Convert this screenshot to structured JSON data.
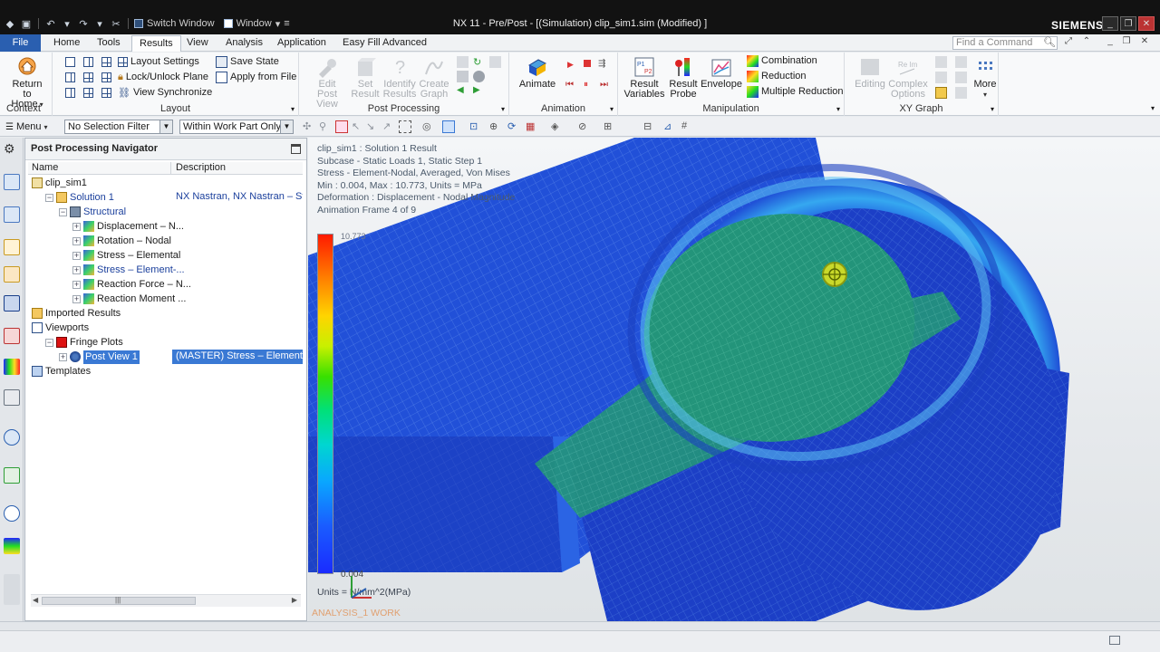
{
  "titlebar": {
    "quick_switch_window": "Switch Window",
    "quick_window": "Window",
    "title": "NX 11 - Pre/Post - [(Simulation) clip_sim1.sim (Modified) ]",
    "brand": "SIEMENS"
  },
  "tabs": [
    "File",
    "Home",
    "Tools",
    "Results",
    "View",
    "Analysis",
    "Application",
    "Easy Fill Advanced"
  ],
  "active_tab": "Results",
  "find_command_placeholder": "Find a Command",
  "ribbon": {
    "context": {
      "return_home": "Return to",
      "return_home2": "Home",
      "label": "Context"
    },
    "layout": {
      "layout_settings": "Layout Settings",
      "lock_unlock_plane": "Lock/Unlock Plane",
      "view_synchronize": "View Synchronize",
      "save_state": "Save State",
      "apply_from_file": "Apply from File",
      "label": "Layout"
    },
    "post_processing": {
      "edit_post_view": [
        "Edit Post",
        "View"
      ],
      "set_result": [
        "Set",
        "Result"
      ],
      "identify_results": [
        "Identify",
        "Results"
      ],
      "create_graph": [
        "Create",
        "Graph"
      ],
      "label": "Post Processing"
    },
    "animation": {
      "animate": "Animate",
      "label": "Animation"
    },
    "manipulation": {
      "result_variables": [
        "Result",
        "Variables"
      ],
      "result_probe": [
        "Result",
        "Probe"
      ],
      "envelope": "Envelope",
      "combination": "Combination",
      "reduction": "Reduction",
      "multiple_reduction": "Multiple Reduction",
      "label": "Manipulation"
    },
    "xy_graph": {
      "editing": "Editing",
      "complex_options": [
        "Complex",
        "Options"
      ],
      "label": "XY Graph"
    },
    "more": "More"
  },
  "command_strip": {
    "menu": "Menu",
    "selection_filter": "No Selection Filter",
    "scope": "Within Work Part Only"
  },
  "navigator": {
    "title": "Post Processing Navigator",
    "columns": {
      "name": "Name",
      "description": "Description"
    },
    "rows": [
      {
        "name": "clip_sim1",
        "desc": "",
        "indent": 0,
        "expander": "",
        "icon": "sim"
      },
      {
        "name": "Solution 1",
        "desc": "NX Nastran, NX Nastran – Str",
        "indent": 1,
        "expander": "−",
        "icon": "folder",
        "blue": true
      },
      {
        "name": "Structural",
        "desc": "",
        "indent": 2,
        "expander": "−",
        "icon": "structural",
        "blue": true
      },
      {
        "name": "Displacement – N...",
        "desc": "",
        "indent": 3,
        "expander": "+",
        "icon": "result"
      },
      {
        "name": "Rotation – Nodal",
        "desc": "",
        "indent": 3,
        "expander": "+",
        "icon": "result"
      },
      {
        "name": "Stress – Elemental",
        "desc": "",
        "indent": 3,
        "expander": "+",
        "icon": "result"
      },
      {
        "name": "Stress – Element-...",
        "desc": "",
        "indent": 3,
        "expander": "+",
        "icon": "result",
        "blue": true
      },
      {
        "name": "Reaction Force – N...",
        "desc": "",
        "indent": 3,
        "expander": "+",
        "icon": "result"
      },
      {
        "name": "Reaction Moment ...",
        "desc": "",
        "indent": 3,
        "expander": "+",
        "icon": "result"
      },
      {
        "name": "Imported Results",
        "desc": "",
        "indent": 0,
        "expander": "",
        "icon": "imported"
      },
      {
        "name": "Viewports",
        "desc": "",
        "indent": 0,
        "expander": "",
        "icon": "viewports"
      },
      {
        "name": "Fringe Plots",
        "desc": "",
        "indent": 1,
        "expander": "−",
        "icon": "fringe"
      },
      {
        "name": "Post View 1",
        "desc": "(MASTER) Stress – Element-N",
        "indent": 2,
        "expander": "+",
        "icon": "postview",
        "selected": true
      },
      {
        "name": "Templates",
        "desc": "",
        "indent": 0,
        "expander": "",
        "icon": "templates"
      }
    ]
  },
  "viewport": {
    "legend_lines": [
      "clip_sim1 : Solution 1 Result",
      "Subcase - Static Loads 1, Static Step 1",
      "Stress - Element-Nodal, Averaged, Von Mises",
      "Min : 0.004, Max : 10.773, Units = MPa",
      "Deformation : Displacement - Nodal Magnitude",
      "Animation Frame 4 of 9"
    ],
    "colorbar_max": "10.773",
    "colorbar_min": "0.004",
    "units": "Units = N/mm^2(MPa)",
    "work_label": "ANALYSIS_1 WORK"
  },
  "colors": {
    "file_tab": "#2a5fb0",
    "selection": "#3a79d4",
    "mesh_blue": "#1f4fd6",
    "mesh_green": "#27a07a",
    "titlebar": "#121212"
  }
}
